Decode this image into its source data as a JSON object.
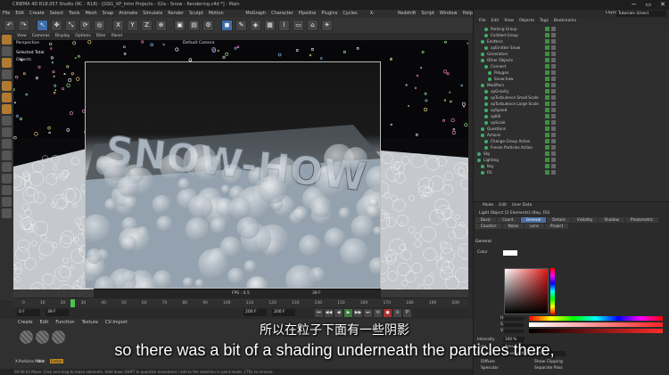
{
  "window": {
    "title": "CINEMA 4D R18.057 Studio (RC - R18) - [GSG_XP_Intro Projects - 02a - Snow - Rendering.c4d *] - Main",
    "controls": [
      "−",
      "▭",
      "✕"
    ]
  },
  "menubar": [
    "File",
    "Edit",
    "Create",
    "Select",
    "Tools",
    "Mesh",
    "Snap",
    "Animate",
    "Simulate",
    "Render",
    "Sculpt",
    "Motion Tracker",
    "MoGraph",
    "Character",
    "Pipeline",
    "Plugins",
    "Cycles 4D",
    "X-Particles",
    "Redshift",
    "Script",
    "Window",
    "Help"
  ],
  "toolbar": {
    "axis_buttons": [
      "X",
      "Y",
      "Z"
    ]
  },
  "viewport": {
    "menu": [
      "View",
      "Cameras",
      "Display",
      "Options",
      "Filter",
      "Panel"
    ],
    "view_name": "Perspective",
    "selected_label": "Selected Total",
    "objects_label": "Objects",
    "camera_label": "Default Camera",
    "fps_label": "FPS : 4.5",
    "frame_readout": "39 F",
    "render_text": "SNOW-HOW"
  },
  "timeline": {
    "ticks": [
      "0",
      "10",
      "20",
      "30",
      "40",
      "50",
      "60",
      "70",
      "80",
      "90",
      "100",
      "110",
      "120",
      "130",
      "140",
      "150",
      "160",
      "170",
      "180",
      "190",
      "200"
    ],
    "start_field": "0 F",
    "current_field": "39 F",
    "end_field": "200 F",
    "end_field2": "200 F"
  },
  "transport": {
    "buttons": [
      "⏮",
      "◀◀",
      "◀",
      "▶",
      "▶▶",
      "⏭",
      "⟲",
      "●",
      "⊙",
      "P"
    ]
  },
  "materials": {
    "menu": [
      "Create",
      "Edit",
      "Function",
      "Texture",
      "CV-Import"
    ],
    "items": [
      "X-Particles Mater",
      "Mat",
      "Ember"
    ]
  },
  "statusbar": {
    "text": "00:00:03  Move: Click and drag to move elements. Hold down SHIFT to quantize movement / add to the selection in point mode, CTRL to remove."
  },
  "right_panel": {
    "layout_label": "Layout:",
    "layout_value": "Tutorials (User)",
    "menu": [
      "File",
      "Edit",
      "View",
      "Objects",
      "Tags",
      "Bookmarks"
    ],
    "objects": [
      {
        "name": "Parking Group",
        "indent": 2
      },
      {
        "name": "Collided Group",
        "indent": 2
      },
      {
        "name": "Emitters",
        "indent": 1
      },
      {
        "name": "xpEmitter Snow",
        "indent": 2
      },
      {
        "name": "Generators",
        "indent": 1
      },
      {
        "name": "Other Objects",
        "indent": 1
      },
      {
        "name": "Connect",
        "indent": 2
      },
      {
        "name": "Polygon",
        "indent": 3
      },
      {
        "name": "Snow-how",
        "indent": 3
      },
      {
        "name": "Modifiers",
        "indent": 1
      },
      {
        "name": "xpGravity",
        "indent": 2
      },
      {
        "name": "xpTurbulence Small Scale",
        "indent": 2
      },
      {
        "name": "xpTurbulence Large Scale",
        "indent": 2
      },
      {
        "name": "xpSpeed",
        "indent": 2
      },
      {
        "name": "xpKill",
        "indent": 2
      },
      {
        "name": "xpScale",
        "indent": 2
      },
      {
        "name": "Questions",
        "indent": 1
      },
      {
        "name": "Actions",
        "indent": 1
      },
      {
        "name": "Change Group Action",
        "indent": 2
      },
      {
        "name": "Freeze Particles Action",
        "indent": 2
      },
      {
        "name": "Sky",
        "indent": 0
      },
      {
        "name": "Lighting",
        "indent": 0
      },
      {
        "name": "Key",
        "indent": 1
      },
      {
        "name": "Fill",
        "indent": 1
      }
    ],
    "attributes": {
      "menu": [
        "Mode",
        "Edit",
        "User Data"
      ],
      "title": "Light Object [2 Elements] (Key, Fill)",
      "tabs": [
        "Basic",
        "Coord.",
        "General",
        "Details",
        "Visibility",
        "Shadow",
        "Photometric",
        "Caustics",
        "Noise",
        "Lens",
        "Project"
      ],
      "active_tab": "General",
      "section": "General",
      "color_label": "Color",
      "intensity_label": "Intensity",
      "intensity_value": "100 %",
      "type_label": "Type",
      "type_value": "Area",
      "shadow_label": "Shadow",
      "shadow_value": "Shadow Maps (Soft)",
      "channel_labels": [
        "H",
        "S",
        "V"
      ],
      "checks": [
        "Diffuse",
        "Show Clipping",
        "Specular",
        "Separate Pass"
      ]
    }
  },
  "subtitles": {
    "chinese": "所以在粒子下面有一些阴影",
    "english": "so there was a bit of a shading underneath the particles there,"
  }
}
